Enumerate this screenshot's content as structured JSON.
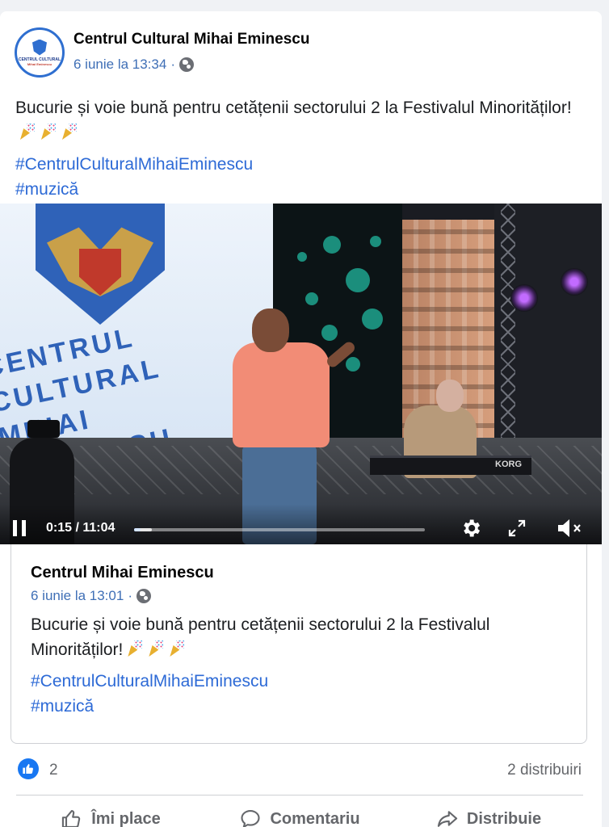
{
  "post": {
    "page_name": "Centrul Cultural Mihai Eminescu",
    "avatar_lines": [
      "CENTRUL CULTURAL",
      "Mihai Eminescu"
    ],
    "timestamp": "6 iunie la 13:34",
    "separator": "·",
    "privacy_icon": "globe-icon",
    "text": "Bucurie și voie bună pentru cetățenii sectorului 2 la Festivalul Minorităților!",
    "hashtags": [
      "#CentrulCulturalMihaiEminescu",
      "#muzică"
    ]
  },
  "video": {
    "scene_text_lines": [
      "CENTRUL CULTURAL",
      "MIHAI EMINESCU"
    ],
    "time": "0:15 / 11:04",
    "progress": 0.023,
    "buffered": 0.06,
    "state": "playing",
    "muted": true,
    "icons": [
      "pause-icon",
      "gear-icon",
      "expand-icon",
      "mute-icon"
    ],
    "keyboard_brand": "KORG"
  },
  "shared_post": {
    "page_name": "Centrul Mihai Eminescu",
    "timestamp": "6 iunie la 13:01",
    "separator": "·",
    "text": "Bucurie și voie bună pentru cetățenii sectorului 2 la Festivalul Minorităților!",
    "hashtags": [
      "#CentrulCulturalMihaiEminescu",
      "#muzică"
    ]
  },
  "reactions": {
    "like_count": "2",
    "shares": "2 distribuiri"
  },
  "actions": {
    "like": "Îmi place",
    "comment": "Comentariu",
    "share": "Distribuie"
  },
  "colors": {
    "link": "#2d6ad6",
    "meta": "#3f6fb6",
    "accent": "#1877f2",
    "muted_text": "#65676b"
  }
}
